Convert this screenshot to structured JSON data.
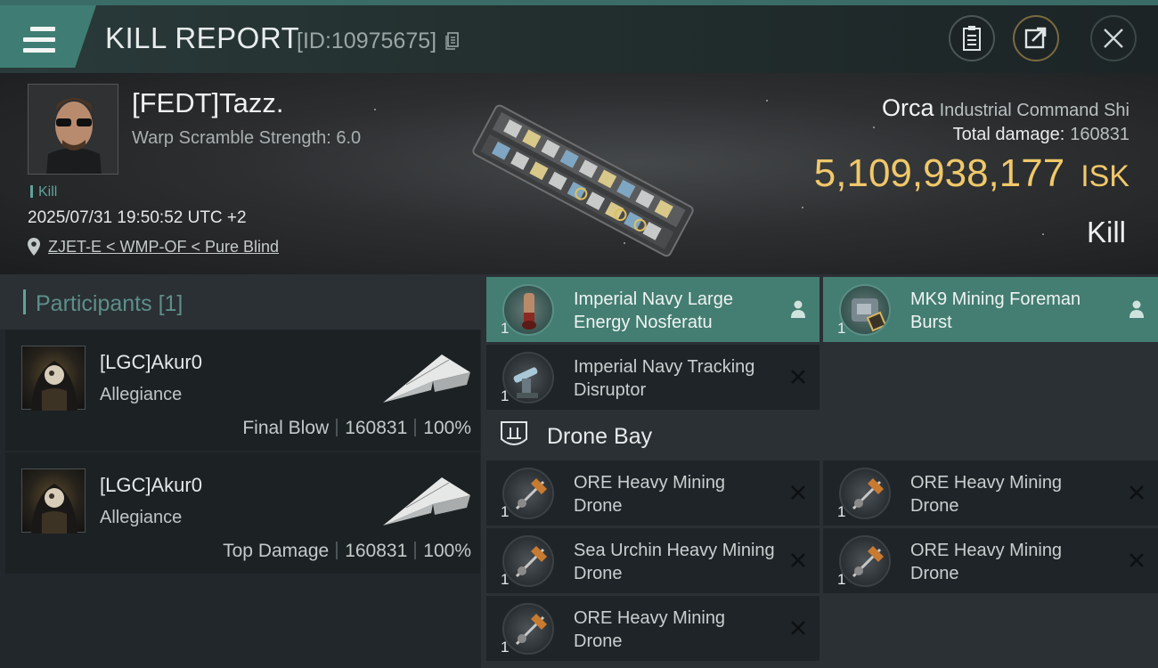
{
  "header": {
    "title": "KILL REPORT",
    "kill_id": "[ID:10975675]",
    "icons": [
      "menu-icon",
      "copy-icon",
      "clipboard-icon",
      "share-icon",
      "close-icon"
    ]
  },
  "victim": {
    "name": "[FEDT]Tazz.",
    "warp_scramble": "Warp Scramble Strength: 6.0",
    "tag": "Kill",
    "datetime": "2025/07/31 19:50:52 UTC +2",
    "location": "ZJET-E < WMP-OF < Pure Blind"
  },
  "ship": {
    "name": "Orca",
    "class": "Industrial Command Shi",
    "total_damage_label": "Total damage:",
    "total_damage": "160831",
    "value": "5,109,938,177",
    "currency": "ISK",
    "result": "Kill"
  },
  "participants": {
    "label": "Participants",
    "count": "[1]",
    "rows": [
      {
        "name": "[LGC]Akur0",
        "corp": "Allegiance",
        "role": "Final Blow",
        "damage": "160831",
        "percent": "100%"
      },
      {
        "name": "[LGC]Akur0",
        "corp": "Allegiance",
        "role": "Top Damage",
        "damage": "160831",
        "percent": "100%"
      }
    ]
  },
  "items": {
    "fitted": [
      {
        "qty": "1",
        "name": "Imperial Navy Large Energy Nosferatu",
        "state": "dropped"
      },
      {
        "qty": "1",
        "name": "MK9 Mining Foreman Burst",
        "state": "dropped"
      },
      {
        "qty": "1",
        "name": "Imperial Navy Tracking Disruptor",
        "state": "destroyed"
      }
    ],
    "drone_bay_label": "Drone Bay",
    "drones": [
      {
        "qty": "1",
        "name": "ORE Heavy Mining Drone"
      },
      {
        "qty": "1",
        "name": "ORE Heavy Mining Drone"
      },
      {
        "qty": "1",
        "name": "Sea Urchin Heavy Mining Drone"
      },
      {
        "qty": "1",
        "name": "ORE Heavy Mining Drone"
      },
      {
        "qty": "1",
        "name": "ORE Heavy Mining Drone"
      }
    ]
  },
  "colors": {
    "accent": "#447d72",
    "isk": "#f0c86a",
    "kill_tag": "#5fa39a"
  }
}
